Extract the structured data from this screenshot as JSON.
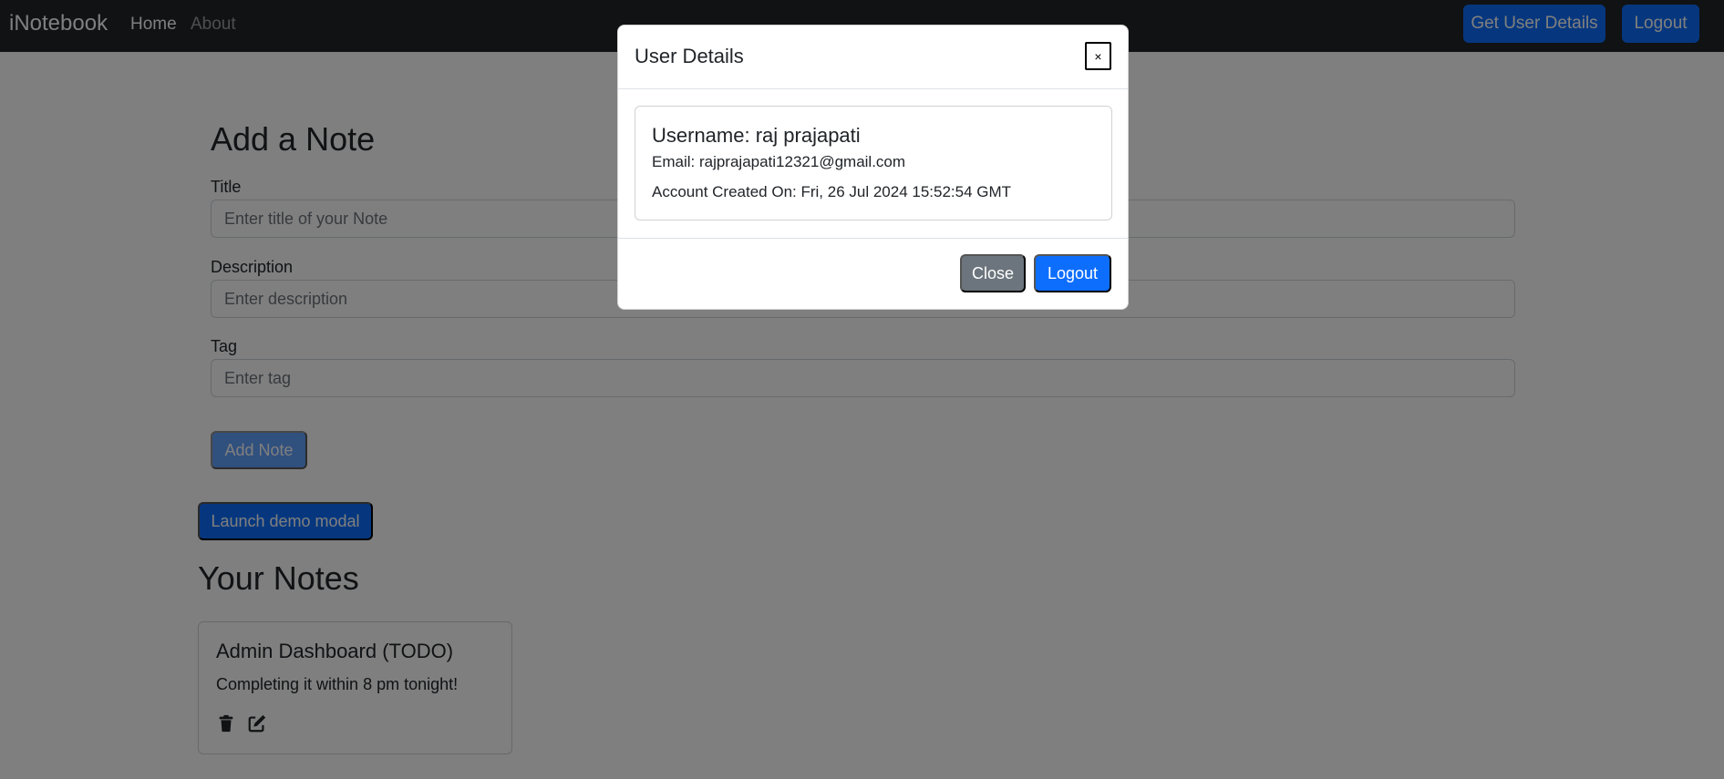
{
  "navbar": {
    "brand": "iNotebook",
    "links": [
      {
        "label": "Home"
      },
      {
        "label": "About"
      }
    ],
    "get_user_details_label": "Get User Details",
    "logout_label": "Logout"
  },
  "add_note": {
    "heading": "Add a Note",
    "title_label": "Title",
    "title_placeholder": "Enter title of your Note",
    "description_label": "Description",
    "description_placeholder": "Enter description",
    "tag_label": "Tag",
    "tag_placeholder": "Enter tag",
    "add_button_label": "Add Note"
  },
  "demo_modal_button_label": "Launch demo modal",
  "notes_section": {
    "heading": "Your Notes",
    "notes": [
      {
        "title": "Admin Dashboard (TODO)",
        "description": "Completing it within 8 pm tonight!",
        "icons": [
          "trash-icon",
          "edit-icon"
        ]
      }
    ]
  },
  "modal": {
    "title": "User Details",
    "close_x": "×",
    "username": "Username: raj prajapati",
    "email": "Email: rajprajapati12321@gmail.com",
    "created": "Account Created On: Fri, 26 Jul 2024 15:52:54 GMT",
    "close_label": "Close",
    "logout_label": "Logout"
  },
  "colors": {
    "navbar_bg": "#212529",
    "primary": "#0d6efd",
    "secondary": "#6c757d"
  }
}
